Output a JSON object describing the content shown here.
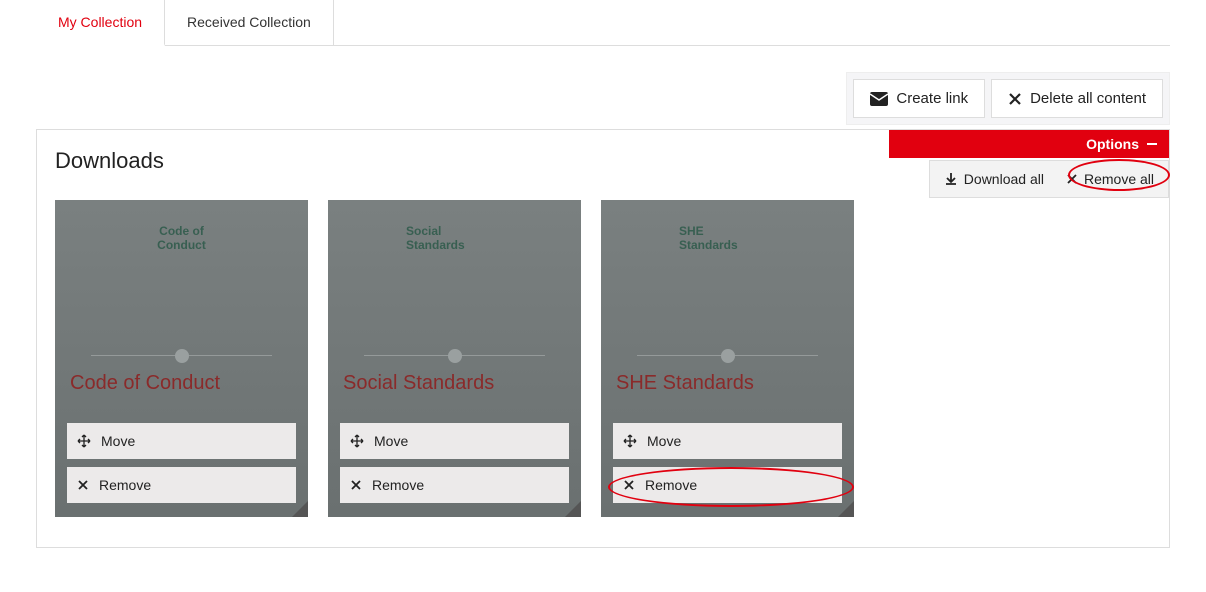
{
  "tabs": {
    "my_collection": "My Collection",
    "received_collection": "Received Collection"
  },
  "toolbar": {
    "create_link": "Create link",
    "delete_all": "Delete all content"
  },
  "section": {
    "title": "Downloads"
  },
  "options": {
    "label": "Options",
    "download_all": "Download all",
    "remove_all": "Remove all"
  },
  "cards": [
    {
      "doc_title": "Code of\nConduct",
      "name": "Code of Conduct",
      "move": "Move",
      "remove": "Remove"
    },
    {
      "doc_title": "Social\nStandards",
      "name": "Social Standards",
      "move": "Move",
      "remove": "Remove"
    },
    {
      "doc_title": "SHE\nStandards",
      "name": "SHE Standards",
      "move": "Move",
      "remove": "Remove"
    }
  ]
}
